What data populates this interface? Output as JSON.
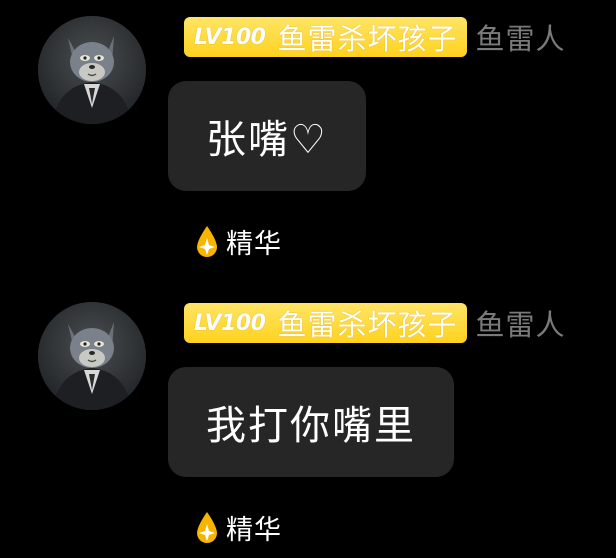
{
  "messages": [
    {
      "badge": {
        "level": "LV100",
        "title": "鱼雷杀坏孩子"
      },
      "username": "鱼雷人",
      "text": "张嘴♡",
      "tag": {
        "icon": "drop-icon",
        "label": "精华"
      }
    },
    {
      "badge": {
        "level": "LV100",
        "title": "鱼雷杀坏孩子"
      },
      "username": "鱼雷人",
      "text": "我打你嘴里",
      "tag": {
        "icon": "drop-icon",
        "label": "精华"
      }
    }
  ],
  "colors": {
    "background": "#000000",
    "badge_gradient_top": "#ffe566",
    "badge_gradient_bottom": "#ffd21e",
    "bubble": "#262626",
    "username": "#7a7a7a",
    "drop_icon": "#f7b500",
    "text": "#ffffff"
  }
}
